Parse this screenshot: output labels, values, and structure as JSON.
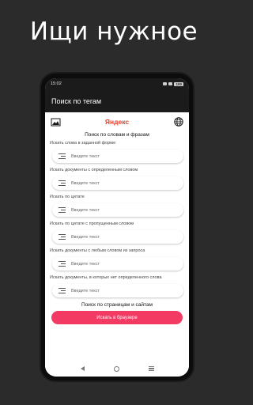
{
  "headline": "Ищи нужное",
  "status": {
    "time": "15:02",
    "battery": "100"
  },
  "appbar": {
    "title": "Поиск по тегам"
  },
  "brand": "Яндекс",
  "section_words": "Поиск по словам и фразам",
  "fields": [
    {
      "label": "Искать слова в заданной форме",
      "placeholder": "Введите текст"
    },
    {
      "label": "Искать документы с определенным словом",
      "placeholder": "Введите текст"
    },
    {
      "label": "Искать по цитате",
      "placeholder": "Введите текст"
    },
    {
      "label": "Искать по цитате с пропущенным словом",
      "placeholder": "Введите текст"
    },
    {
      "label": "Искать документы с любым словом из запроса",
      "placeholder": "Введите текст"
    },
    {
      "label": "Искать документы, в которых нет определенного слова",
      "placeholder": "Введите текст"
    }
  ],
  "section_pages": "Поиск по страницам и сайтам",
  "browser_button": "Искать в браузере",
  "colors": {
    "accent": "#f23a63",
    "brand": "#e8412b",
    "appbar": "#1b1b1b",
    "background": "#2b2b2b"
  },
  "icons": {
    "left": "image-icon",
    "right": "globe-icon"
  }
}
